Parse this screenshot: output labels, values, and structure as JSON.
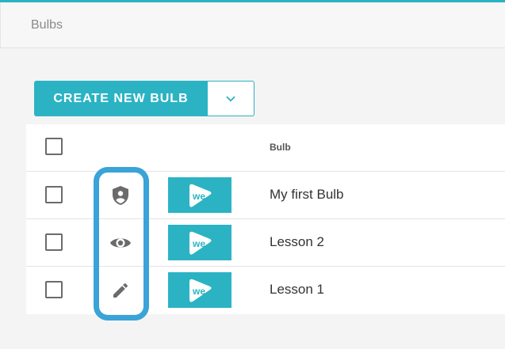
{
  "header": {
    "breadcrumb": "Bulbs"
  },
  "toolbar": {
    "create_label": "CREATE NEW BULB",
    "dropdown_icon": "chevron-down-icon"
  },
  "table": {
    "columns": {
      "bulb": "Bulb"
    },
    "rows": [
      {
        "name": "My first Bulb",
        "status_icon": "shield-person-icon",
        "thumb_text": "we"
      },
      {
        "name": "Lesson 2",
        "status_icon": "eye-icon",
        "thumb_text": "we"
      },
      {
        "name": "Lesson 1",
        "status_icon": "pencil-icon",
        "thumb_text": "we"
      }
    ]
  },
  "colors": {
    "accent": "#2bb3c4",
    "highlight": "#3aa3d8"
  }
}
